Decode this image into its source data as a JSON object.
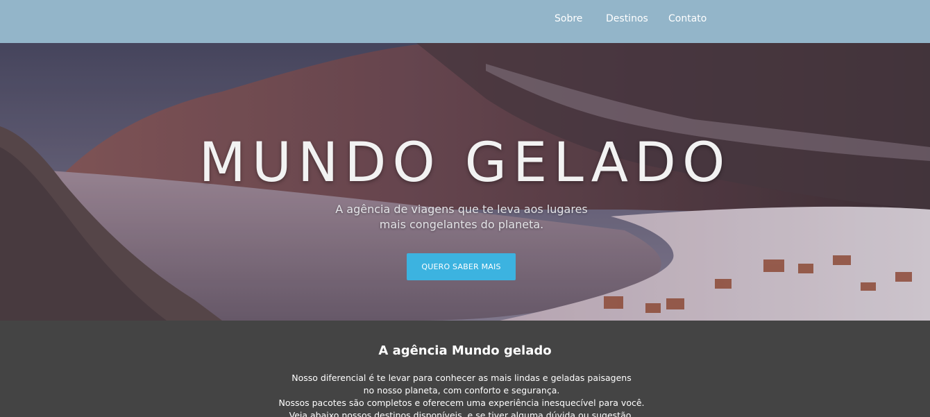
{
  "nav": {
    "items": [
      {
        "label": "Sobre"
      },
      {
        "label": "Destinos"
      },
      {
        "label": "Contato"
      }
    ]
  },
  "hero": {
    "title": "MUNDO GELADO",
    "subtitle_line1": "A agência de viagens que te leva aos lugares",
    "subtitle_line2": "mais congelantes do planeta.",
    "cta_label": "QUERO SABER MAIS"
  },
  "about": {
    "title": "A agência Mundo gelado",
    "lines": [
      "Nosso diferencial é te levar para conhecer as mais lindas e geladas paisagens",
      "no nosso planeta, com conforto e segurança.",
      "Nossos pacotes são completos e oferecem uma experiência inesquecível para você.",
      "Veja abaixo nossos destinos disponíveis, e se tiver alguma dúvida ou sugestão,"
    ]
  },
  "colors": {
    "navbar": "#93b5c9",
    "button": "#3cb3e0",
    "section_bg": "#444444"
  }
}
